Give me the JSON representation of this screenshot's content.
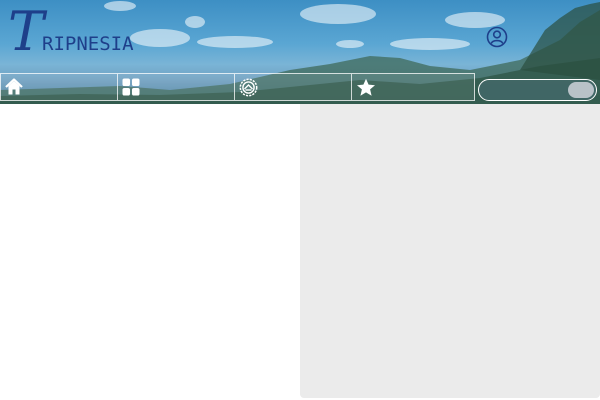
{
  "brand": {
    "logo_initial": "T",
    "logo_rest": "RIPNESIA"
  },
  "header": {
    "user_icon": "user-circle-icon"
  },
  "nav": {
    "items": [
      {
        "icon": "home-icon"
      },
      {
        "icon": "grid-icon"
      },
      {
        "icon": "badge-icon"
      },
      {
        "icon": "star-icon"
      }
    ]
  },
  "search": {
    "value": "",
    "placeholder": ""
  },
  "colors": {
    "logo": "#1e3f8a",
    "panel": "#ebebeb",
    "nav_border": "#ffffff"
  }
}
